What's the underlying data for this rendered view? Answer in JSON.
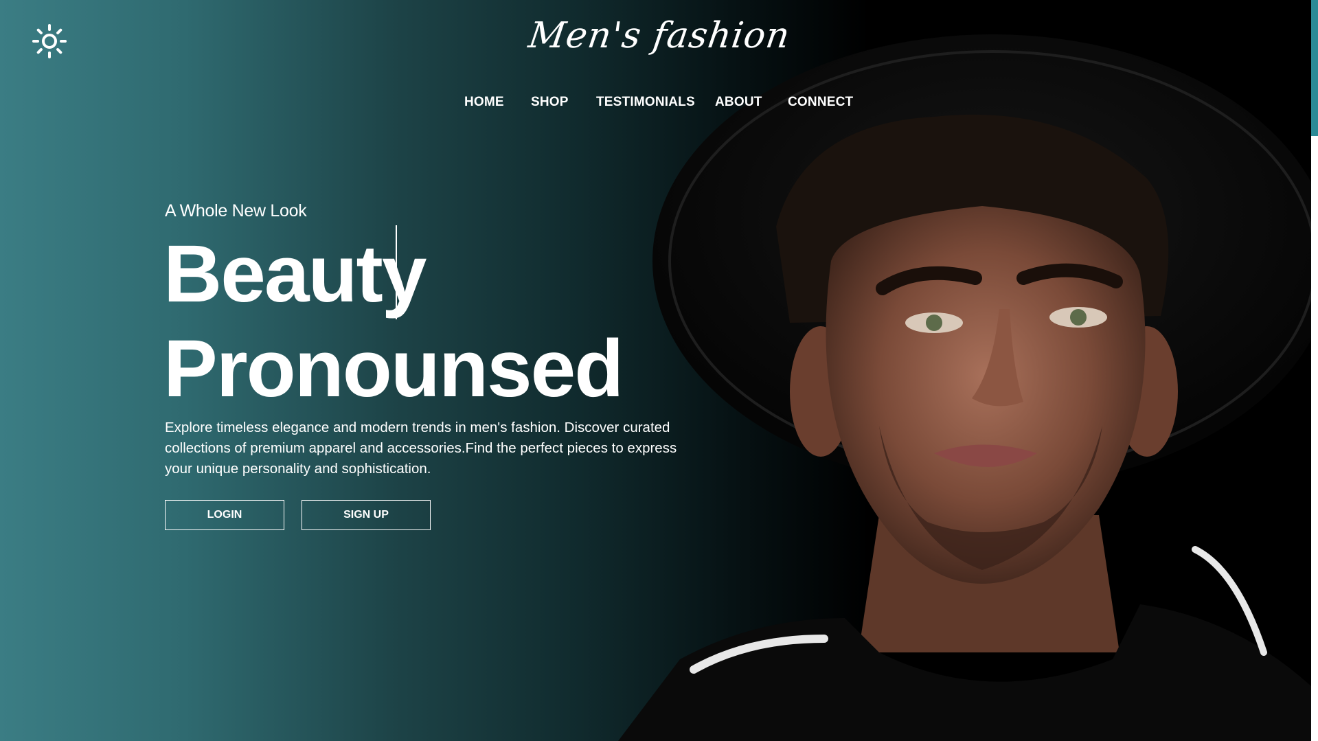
{
  "header": {
    "logo_text": "Men's fashion",
    "theme_icon": "sun-icon"
  },
  "nav": {
    "items": [
      {
        "label": "HOME"
      },
      {
        "label": "SHOP"
      },
      {
        "label": "TESTIMONIALS"
      },
      {
        "label": "ABOUT"
      },
      {
        "label": "CONNECT"
      }
    ]
  },
  "hero": {
    "eyebrow": "A Whole New Look",
    "headline_line1": "Beauty",
    "headline_line2": "Pronounsed",
    "description": "Explore timeless elegance and modern trends in men's fashion. Discover curated collections of premium apparel and accessories.Find the perfect pieces to express your unique personality and sophistication.",
    "login_label": "LOGIN",
    "signup_label": "SIGN UP"
  },
  "colors": {
    "gradient_left": "#3b7d84",
    "gradient_right": "#000000",
    "scroll_thumb": "#2b8a96",
    "text": "#ffffff"
  }
}
